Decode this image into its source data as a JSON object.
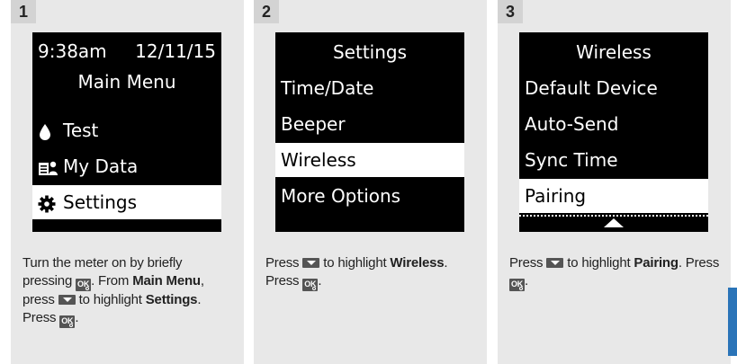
{
  "panels": [
    {
      "step": "1",
      "screen": {
        "header_time": "9:38am",
        "header_date": "12/11/15",
        "title": "Main Menu",
        "items": [
          {
            "icon": "drop-icon",
            "label": "Test"
          },
          {
            "icon": "my-data-icon",
            "label": "My Data"
          },
          {
            "icon": "gear-icon",
            "label": "Settings",
            "highlighted": true
          }
        ]
      },
      "text": {
        "a": "Turn the meter on by briefly pressing ",
        "b": ". From ",
        "c": "Main Menu",
        "d": ", press ",
        "e": " to highlight ",
        "f": "Settings",
        "g": ". Press ",
        "h": "."
      }
    },
    {
      "step": "2",
      "screen": {
        "title": "Settings",
        "items": [
          {
            "label": "Time/Date"
          },
          {
            "label": "Beeper"
          },
          {
            "label": "Wireless",
            "highlighted": true
          },
          {
            "label": "More Options"
          }
        ]
      },
      "text": {
        "a": "Press ",
        "b": " to highlight ",
        "c": "Wireless",
        "d": ". Press ",
        "e": "."
      }
    },
    {
      "step": "3",
      "screen": {
        "title": "Wireless",
        "items": [
          {
            "label": "Default Device"
          },
          {
            "label": "Auto-Send"
          },
          {
            "label": "Sync Time"
          },
          {
            "label": "Pairing",
            "highlighted": true
          }
        ]
      },
      "text": {
        "a": "Press ",
        "b": " to highlight ",
        "c": "Pairing",
        "d": ". Press ",
        "e": "."
      }
    }
  ],
  "buttons": {
    "ok_label": "OK"
  },
  "colors": {
    "panel_bg": "#e8e8e8",
    "screen_bg": "#000000",
    "side_tab": "#2a74b8"
  }
}
